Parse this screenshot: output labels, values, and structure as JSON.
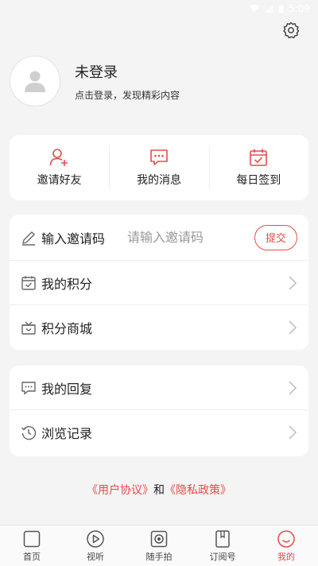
{
  "status_bar": {
    "time": "5:09"
  },
  "profile": {
    "name": "未登录",
    "subtitle": "点击登录，发现精彩内容"
  },
  "quick_actions": [
    {
      "label": "邀请好友",
      "icon": "invite-user-icon"
    },
    {
      "label": "我的消息",
      "icon": "message-icon"
    },
    {
      "label": "每日签到",
      "icon": "calendar-check-icon"
    }
  ],
  "invite": {
    "label": "输入邀请码",
    "placeholder": "请输入邀请码",
    "submit_label": "提交"
  },
  "list1": [
    {
      "label": "我的积分",
      "icon": "points-icon"
    },
    {
      "label": "积分商城",
      "icon": "gift-box-icon"
    }
  ],
  "list2": [
    {
      "label": "我的回复",
      "icon": "chat-bubble-icon"
    },
    {
      "label": "浏览记录",
      "icon": "history-icon"
    }
  ],
  "agreement": {
    "user_agreement": "《用户协议》",
    "and": "和",
    "privacy_policy": "《隐私政策》"
  },
  "tabbar": [
    {
      "label": "首页",
      "icon": "home-icon"
    },
    {
      "label": "视听",
      "icon": "play-icon"
    },
    {
      "label": "随手拍",
      "icon": "camera-icon"
    },
    {
      "label": "订阅号",
      "icon": "subscription-icon"
    },
    {
      "label": "我的",
      "icon": "profile-icon",
      "active": true
    }
  ],
  "colors": {
    "accent": "#e84a4a",
    "background": "#f4f4f4"
  }
}
